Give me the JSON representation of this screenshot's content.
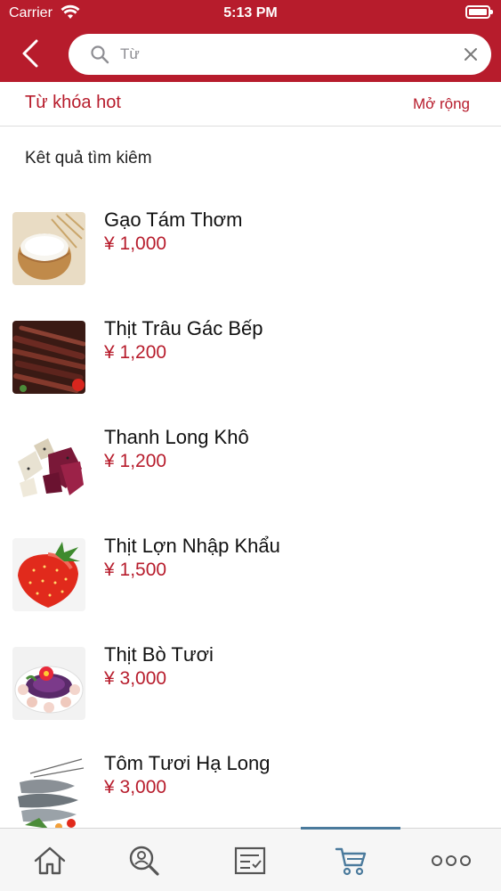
{
  "status_bar": {
    "carrier": "Carrier",
    "time": "5:13 PM"
  },
  "search": {
    "placeholder": "Từ",
    "value": ""
  },
  "hot_keywords": {
    "title": "Từ khóa hot",
    "expand_label": "Mở rộng"
  },
  "results": {
    "title": "Kêt quả tìm kiêm",
    "items": [
      {
        "name": "Gạo Tám Thơm",
        "price": "¥ 1,000",
        "image": "rice-bowl"
      },
      {
        "name": "Thịt Trâu Gác Bếp",
        "price": "¥ 1,200",
        "image": "dried-buffalo-meat"
      },
      {
        "name": "Thanh Long Khô",
        "price": "¥ 1,200",
        "image": "dried-dragon-fruit"
      },
      {
        "name": "Thịt Lợn Nhập Khẩu",
        "price": "¥ 1,500",
        "image": "strawberry"
      },
      {
        "name": "Thịt Bò Tươi",
        "price": "¥ 3,000",
        "image": "seafood-platter"
      },
      {
        "name": "Tôm Tươi Hạ Long",
        "price": "¥ 3,000",
        "image": "shrimp"
      }
    ]
  },
  "tab_bar": {
    "tabs": [
      {
        "icon": "home-icon"
      },
      {
        "icon": "search-user-icon"
      },
      {
        "icon": "checklist-icon"
      },
      {
        "icon": "cart-icon",
        "active": true
      },
      {
        "icon": "more-icon"
      }
    ]
  },
  "colors": {
    "brand": "#b71c2c",
    "active_tab": "#4a7a9c",
    "tab_icon": "#555555"
  }
}
